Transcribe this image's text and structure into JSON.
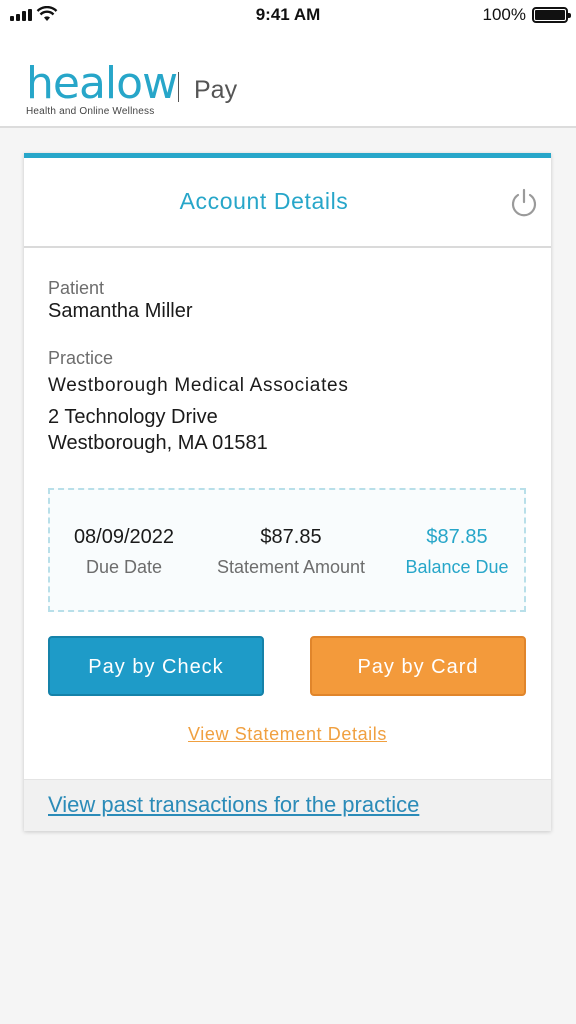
{
  "status_bar": {
    "time": "9:41 AM",
    "battery": "100%"
  },
  "header": {
    "logo_word": "healow",
    "logo_tagline": "Health and Online Wellness",
    "product": "Pay"
  },
  "card": {
    "title": "Account Details",
    "patient_label": "Patient",
    "patient_name": "Samantha Miller",
    "practice_label": "Practice",
    "practice_name": "Westborough Medical Associates",
    "address_line1": "2 Technology Drive",
    "address_line2": "Westborough, MA 01581",
    "summary": {
      "due_date": "08/09/2022",
      "due_date_label": "Due Date",
      "statement_amount": "$87.85",
      "statement_amount_label": "Statement Amount",
      "balance_due": "$87.85",
      "balance_due_label": "Balance Due"
    },
    "pay_check_label": "Pay by Check",
    "pay_card_label": "Pay by Card",
    "statement_link": "View Statement Details",
    "past_transactions_link": "View past transactions for the practice"
  },
  "colors": {
    "accent": "#27a6c9",
    "check_button": "#1e9bc8",
    "card_button": "#f39a3b",
    "link_orange": "#f0a040"
  },
  "icons": [
    "signal-icon",
    "wifi-icon",
    "battery-icon",
    "power-icon"
  ]
}
